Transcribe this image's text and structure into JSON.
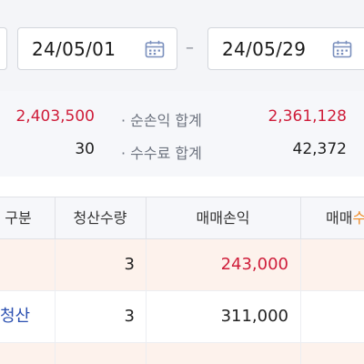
{
  "date_range": {
    "from": "24/05/01",
    "to": "24/05/29",
    "separator": "–"
  },
  "summary": {
    "left_values": [
      "2,403,500",
      "30"
    ],
    "right_rows": [
      {
        "label": "· 순손익 합계",
        "value": "2,361,128"
      },
      {
        "label": "· 수수료 합계",
        "value": "42,372"
      }
    ]
  },
  "table": {
    "headers": [
      "구분",
      "청산수량",
      "매매손익",
      "매매수"
    ],
    "header_partial_highlight": "수",
    "rows": [
      {
        "type": "",
        "qty": "3",
        "pnl": "243,000",
        "highlight": true
      },
      {
        "type": "청산",
        "qty": "3",
        "pnl": "311,000",
        "highlight": false
      },
      {
        "type": "",
        "qty": "",
        "pnl": "",
        "highlight": true
      }
    ]
  },
  "colors": {
    "profit_red": "#cf1d3a",
    "link_blue": "#2a4fb0",
    "highlight_row": "#fdf2ec",
    "accent_orange": "#f08a24"
  },
  "icons": [
    "calendar-icon"
  ]
}
